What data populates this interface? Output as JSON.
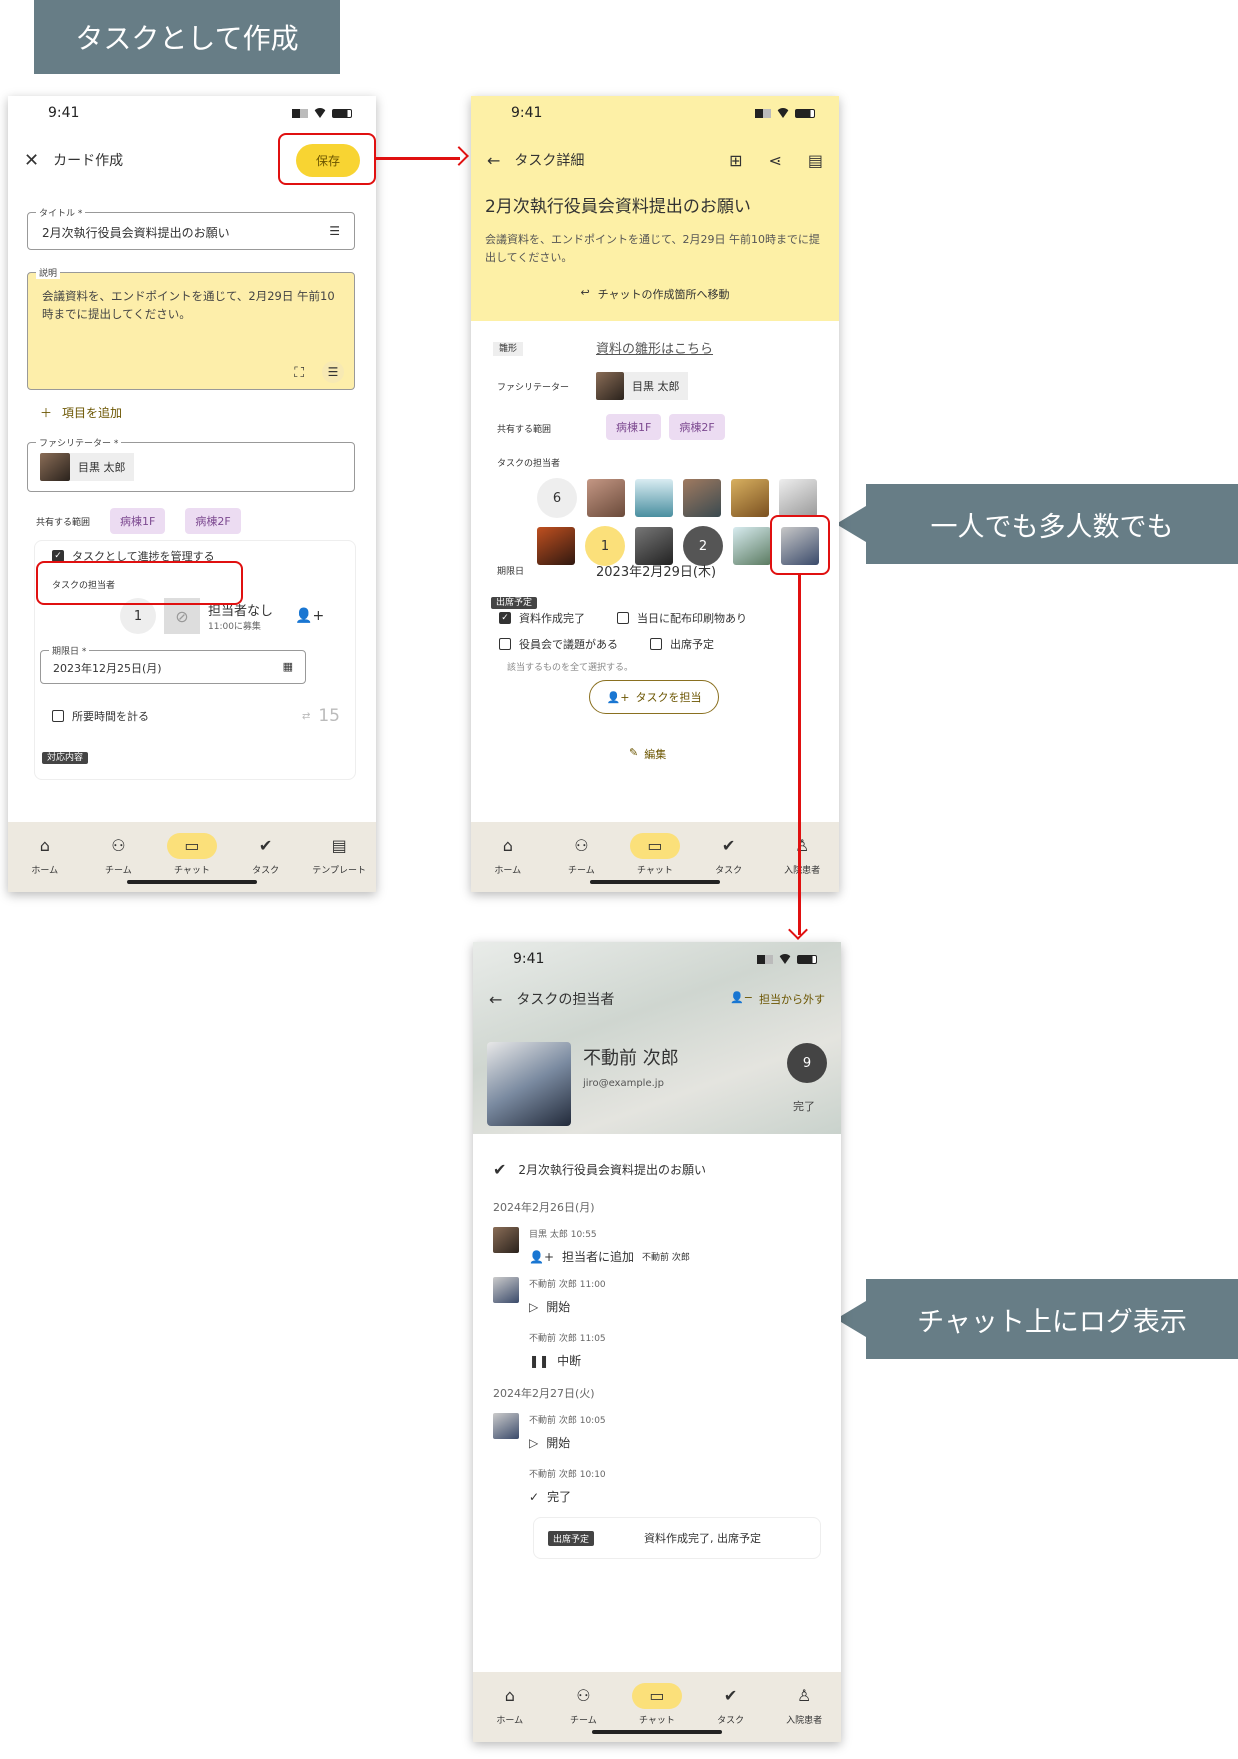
{
  "banner_top": "タスクとして作成",
  "banner_right1": "一人でも多人数でも",
  "banner_right2": "チャット上にログ表示",
  "time": "9:41",
  "nav1": [
    "ホーム",
    "チーム",
    "チャット",
    "タスク",
    "テンプレート"
  ],
  "nav2": [
    "ホーム",
    "チーム",
    "チャット",
    "タスク",
    "入院患者"
  ],
  "p1": {
    "title": "カード作成",
    "save": "保存",
    "title_legend": "タイトル *",
    "title_value": "2月次執行役員会資料提出のお願い",
    "desc_legend": "説明",
    "desc_value": "会議資料を、エンドポイントを通じて、2月29日 午前10時までに提出してください。",
    "add_item": "項目を追加",
    "facilitator_legend": "ファシリテーター *",
    "facilitator": "目黒 太郎",
    "scope_label": "共有する範囲",
    "chips": [
      "病棟1F",
      "病棟2F"
    ],
    "manage_progress": "タスクとして進捗を管理する",
    "assignee_label": "タスクの担当者",
    "assignee_count": "1",
    "no_assignee": "担当者なし",
    "recruit": "11:00に募集",
    "due_legend": "期限日 *",
    "due_value": "2023年12月25日(月)",
    "time_required": "所要時間を計る",
    "time_num": "15",
    "response_tag": "対応内容"
  },
  "p2": {
    "title": "タスク詳細",
    "heading": "2月次執行役員会資料提出のお願い",
    "desc": "会議資料を、エンドポイントを通じて、2月29日 午前10時までに提出してください。",
    "jump": "チャットの作成箇所へ移動",
    "template_label": "雛形",
    "template_link": "資料の雛形はこちら",
    "facilitator_label": "ファシリテーター",
    "facilitator": "目黒 太郎",
    "scope_label": "共有する範囲",
    "chips": [
      "病棟1F",
      "病棟2F"
    ],
    "assignee_label": "タスクの担当者",
    "counts": [
      "6",
      "1",
      "2"
    ],
    "due_label": "期限日",
    "due_value": "2023年2月29日(木)",
    "attend_tag": "出席予定",
    "checks": [
      "資料作成完了",
      "当日に配布印刷物あり",
      "役員会で議題がある",
      "出席予定"
    ],
    "check_hint": "該当するものを全て選択する。",
    "take_task": "タスクを担当",
    "edit": "編集"
  },
  "p3": {
    "title": "タスクの担当者",
    "remove": "担当から外す",
    "name": "不動前 次郎",
    "email": "jiro@example.jp",
    "done_count": "9",
    "done_label": "完了",
    "task_title": "2月次執行役員会資料提出のお願い",
    "date1": "2024年2月26日(月)",
    "log1_meta": "目黒 太郎  10:55",
    "log1_action": "担当者に追加",
    "log1_target": "不動前 次郎",
    "log2_meta": "不動前 次郎  11:00",
    "log2_action": "開始",
    "log3_meta": "不動前 次郎  11:05",
    "log3_action": "中断",
    "date2": "2024年2月27日(火)",
    "log4_meta": "不動前 次郎  10:05",
    "log4_action": "開始",
    "log5_meta": "不動前 次郎  10:10",
    "log5_action": "完了",
    "result_tag": "出席予定",
    "result_text": "資料作成完了, 出席予定"
  }
}
